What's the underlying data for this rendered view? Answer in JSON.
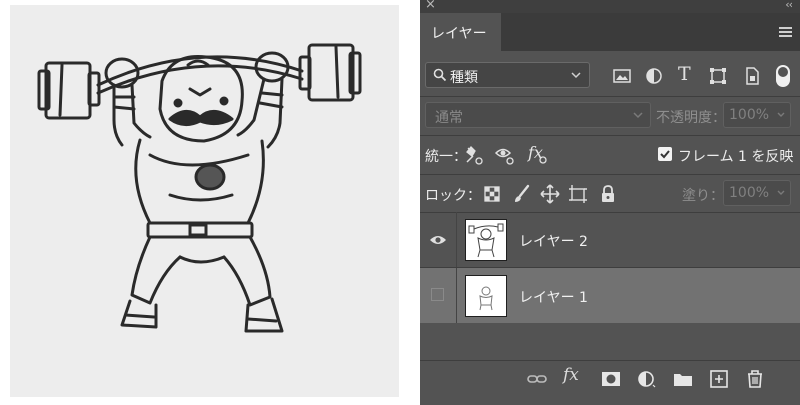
{
  "panel": {
    "close_glyph": "×",
    "collapse_glyph": "‹‹",
    "tab_label": "レイヤー",
    "menu_icon": "hamburger-menu-icon"
  },
  "filter": {
    "kind_label": "種類",
    "icons": [
      "image-filter-icon",
      "adjustment-filter-icon",
      "type-filter-icon",
      "shape-filter-icon",
      "smart-object-filter-icon"
    ],
    "type_glyph": "T"
  },
  "blend": {
    "mode": "通常",
    "opacity_label": "不透明度：",
    "opacity_value": "100%"
  },
  "unify": {
    "label": "統一：",
    "fx": "fx",
    "propagate_checked": true,
    "propagate_label": "フレーム 1 を反映"
  },
  "lock": {
    "label": "ロック：",
    "fill_label": "塗り：",
    "fill_value": "100%"
  },
  "layers": [
    {
      "name": "レイヤー 2",
      "visible": true,
      "selected": false
    },
    {
      "name": "レイヤー 1",
      "visible": false,
      "selected": true
    }
  ],
  "bottom": {
    "fx": "fx",
    "icons": [
      "link-layers-icon",
      "add-style-icon",
      "add-mask-icon",
      "adjustment-layer-icon",
      "new-group-icon",
      "new-layer-icon",
      "delete-layer-icon"
    ]
  },
  "colors": {
    "panel_bg": "#535353",
    "tab_bar": "#3b3b3b",
    "selected_row": "#727272",
    "canvas_bg": "#ededed"
  }
}
